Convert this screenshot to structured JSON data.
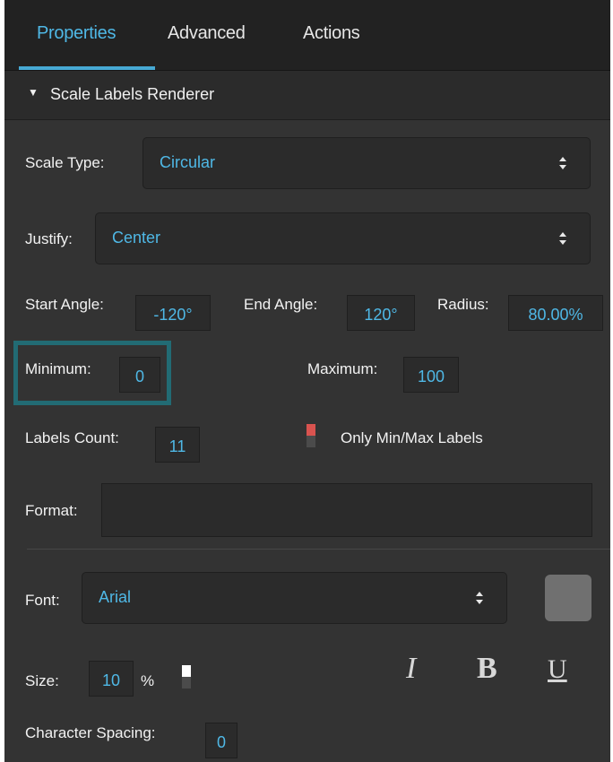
{
  "tabs": [
    {
      "label": "Properties",
      "active": true
    },
    {
      "label": "Advanced",
      "active": false
    },
    {
      "label": "Actions",
      "active": false
    }
  ],
  "section": {
    "title": "Scale Labels Renderer",
    "expanded": true
  },
  "scale_type": {
    "label": "Scale Type:",
    "value": "Circular"
  },
  "justify": {
    "label": "Justify:",
    "value": "Center"
  },
  "angles": {
    "start_label": "Start Angle:",
    "start_value": "-120°",
    "end_label": "End Angle:",
    "end_value": "120°",
    "radius_label": "Radius:",
    "radius_value": "80.00%"
  },
  "range": {
    "min_label": "Minimum:",
    "min_value": "0",
    "max_label": "Maximum:",
    "max_value": "100"
  },
  "labels": {
    "count_label": "Labels Count:",
    "count_value": "11",
    "only_minmax_label": "Only Min/Max Labels"
  },
  "format": {
    "label": "Format:",
    "value": ""
  },
  "font": {
    "label": "Font:",
    "value": "Arial",
    "color": "#707070"
  },
  "size": {
    "label": "Size:",
    "value": "10",
    "unit": "%"
  },
  "style_buttons": {
    "italic": "I",
    "bold": "B",
    "underline": "U"
  },
  "char_spacing": {
    "label": "Character Spacing:",
    "value": "0"
  },
  "colors": {
    "accent": "#4fb8e6",
    "highlight": "#226b74",
    "panel": "#333333",
    "checkbox_on": "#d9534f"
  }
}
